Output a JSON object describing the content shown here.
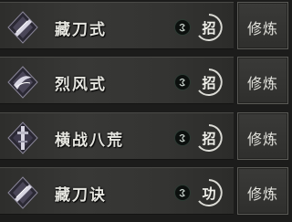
{
  "skills": [
    {
      "name": "藏刀式",
      "tag": "招",
      "type_icon": "swirl-icon",
      "skill_icon": "blade-emblem-icon",
      "train_label": "修炼"
    },
    {
      "name": "烈风式",
      "tag": "招",
      "type_icon": "swirl-icon",
      "skill_icon": "wind-blade-icon",
      "train_label": "修炼"
    },
    {
      "name": "横战八荒",
      "tag": "招",
      "type_icon": "swirl-icon",
      "skill_icon": "sword-pillar-icon",
      "train_label": "修炼"
    },
    {
      "name": "藏刀诀",
      "tag": "功",
      "type_icon": "swirl-icon",
      "skill_icon": "blade-emblem-icon",
      "train_label": "修炼"
    }
  ]
}
